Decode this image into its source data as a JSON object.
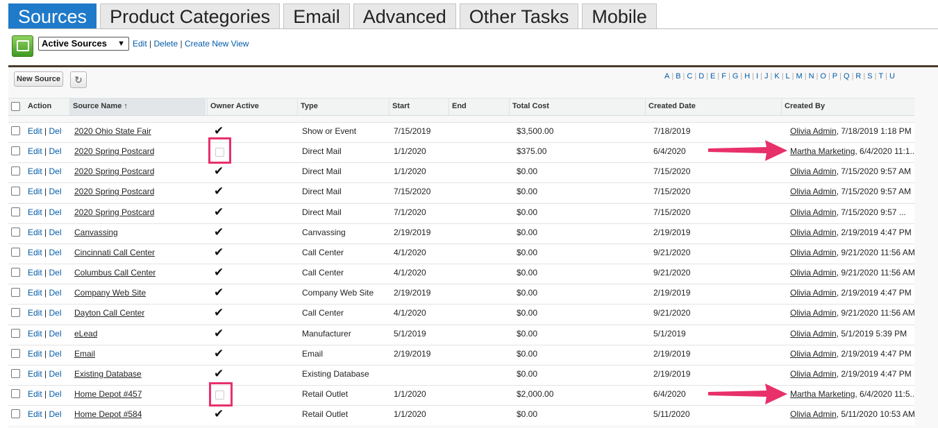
{
  "tabs": [
    "Sources",
    "Product Categories",
    "Email",
    "Advanced",
    "Other Tasks",
    "Mobile"
  ],
  "view": {
    "selected": "Active Sources",
    "links": [
      "Edit",
      "Delete",
      "Create New View"
    ]
  },
  "buttons": {
    "new_source": "New Source"
  },
  "alphabet": [
    "A",
    "B",
    "C",
    "D",
    "E",
    "F",
    "G",
    "H",
    "I",
    "J",
    "K",
    "L",
    "M",
    "N",
    "O",
    "P",
    "Q",
    "R",
    "S",
    "T",
    "U"
  ],
  "columns": [
    "Action",
    "Source Name",
    "Owner Active",
    "Type",
    "Start",
    "End",
    "Total Cost",
    "Created Date",
    "Created By"
  ],
  "sort_indicator": "↑",
  "row_actions": {
    "edit": "Edit",
    "del": "Del"
  },
  "rows": [
    {
      "name": "2020 Ohio State Fair",
      "owner_active": true,
      "type": "Show or Event",
      "start": "7/15/2019",
      "end": "",
      "cost": "$3,500.00",
      "created": "7/18/2019",
      "by": "Olivia Admin",
      "by_time": ", 7/18/2019 1:18 PM"
    },
    {
      "name": "2020 Spring Postcard",
      "owner_active": false,
      "type": "Direct Mail",
      "start": "1/1/2020",
      "end": "",
      "cost": "$375.00",
      "created": "6/4/2020",
      "by": "Martha Marketing",
      "by_time": ", 6/4/2020 11:1..."
    },
    {
      "name": "2020 Spring Postcard",
      "owner_active": true,
      "type": "Direct Mail",
      "start": "1/1/2020",
      "end": "",
      "cost": "$0.00",
      "created": "7/15/2020",
      "by": "Olivia Admin",
      "by_time": ", 7/15/2020 9:57 AM"
    },
    {
      "name": "2020 Spring Postcard",
      "owner_active": true,
      "type": "Direct Mail",
      "start": "7/15/2020",
      "end": "",
      "cost": "$0.00",
      "created": "7/15/2020",
      "by": "Olivia Admin",
      "by_time": ", 7/15/2020 9:57 AM"
    },
    {
      "name": "2020 Spring Postcard",
      "owner_active": true,
      "type": "Direct Mail",
      "start": "7/1/2020",
      "end": "",
      "cost": "$0.00",
      "created": "7/15/2020",
      "by": "Olivia Admin",
      "by_time": ", 7/15/2020 9:57 ..."
    },
    {
      "name": "Canvassing",
      "owner_active": true,
      "type": "Canvassing",
      "start": "2/19/2019",
      "end": "",
      "cost": "$0.00",
      "created": "2/19/2019",
      "by": "Olivia Admin",
      "by_time": ", 2/19/2019 4:47 PM"
    },
    {
      "name": "Cincinnati Call Center",
      "owner_active": true,
      "type": "Call Center",
      "start": "4/1/2020",
      "end": "",
      "cost": "$0.00",
      "created": "9/21/2020",
      "by": "Olivia Admin",
      "by_time": ", 9/21/2020 11:56 AM"
    },
    {
      "name": "Columbus Call Center",
      "owner_active": true,
      "type": "Call Center",
      "start": "4/1/2020",
      "end": "",
      "cost": "$0.00",
      "created": "9/21/2020",
      "by": "Olivia Admin",
      "by_time": ", 9/21/2020 11:56 AM"
    },
    {
      "name": "Company Web Site",
      "owner_active": true,
      "type": "Company Web Site",
      "start": "2/19/2019",
      "end": "",
      "cost": "$0.00",
      "created": "2/19/2019",
      "by": "Olivia Admin",
      "by_time": ", 2/19/2019 4:47 PM"
    },
    {
      "name": "Dayton Call Center",
      "owner_active": true,
      "type": "Call Center",
      "start": "4/1/2020",
      "end": "",
      "cost": "$0.00",
      "created": "9/21/2020",
      "by": "Olivia Admin",
      "by_time": ", 9/21/2020 11:56 AM"
    },
    {
      "name": "eLead",
      "owner_active": true,
      "type": "Manufacturer",
      "start": "5/1/2019",
      "end": "",
      "cost": "$0.00",
      "created": "5/1/2019",
      "by": "Olivia Admin",
      "by_time": ", 5/1/2019 5:39 PM"
    },
    {
      "name": "Email",
      "owner_active": true,
      "type": "Email",
      "start": "2/19/2019",
      "end": "",
      "cost": "$0.00",
      "created": "2/19/2019",
      "by": "Olivia Admin",
      "by_time": ", 2/19/2019 4:47 PM"
    },
    {
      "name": "Existing Database",
      "owner_active": true,
      "type": "Existing Database",
      "start": "",
      "end": "",
      "cost": "$0.00",
      "created": "2/19/2019",
      "by": "Olivia Admin",
      "by_time": ", 2/19/2019 4:47 PM"
    },
    {
      "name": "Home Depot #457",
      "owner_active": false,
      "type": "Retail Outlet",
      "start": "1/1/2020",
      "end": "",
      "cost": "$2,000.00",
      "created": "6/4/2020",
      "by": "Martha Marketing",
      "by_time": ", 6/4/2020 11:5..."
    },
    {
      "name": "Home Depot #584",
      "owner_active": true,
      "type": "Retail Outlet",
      "start": "1/1/2020",
      "end": "",
      "cost": "$0.00",
      "created": "5/11/2020",
      "by": "Olivia Admin",
      "by_time": ", 5/11/2020 10:53 AM"
    }
  ],
  "colors": {
    "tab_active": "#1f7ac9",
    "annotation": "#e8306a",
    "link": "#015ba7"
  }
}
